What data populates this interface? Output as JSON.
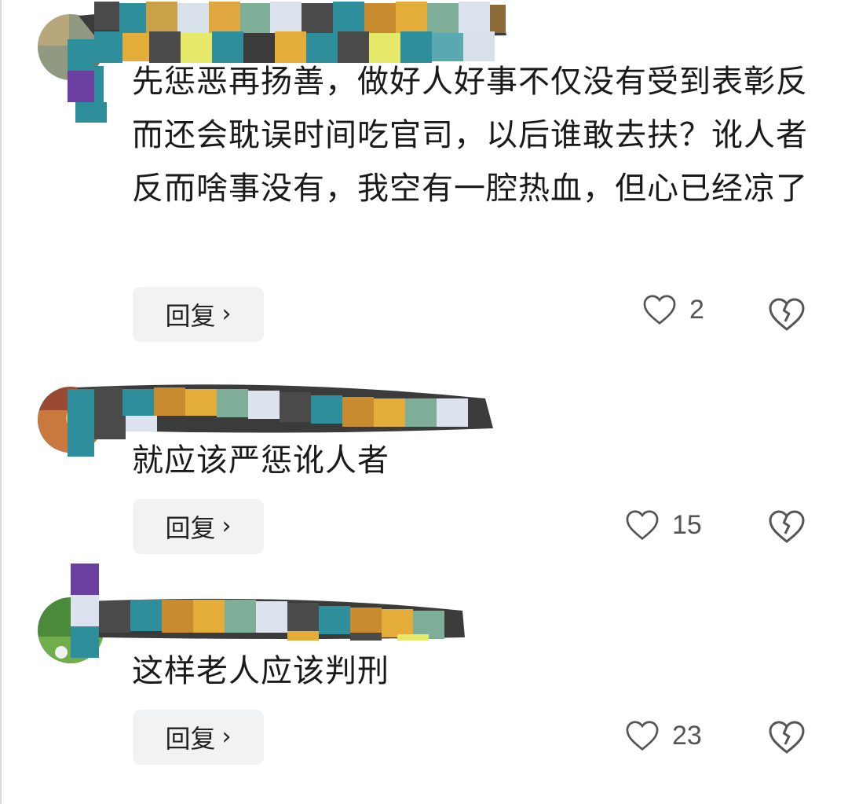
{
  "comments": [
    {
      "text": "先惩恶再扬善，做好人好事不仅没有受到表彰反而还会耽误时间吃官司，以后谁敢去扶？讹人者反而啥事没有，我空有一腔热血，但心已经凉了",
      "reply_label": "回复",
      "reply_chevron": "›",
      "like_count": "2",
      "like_icon": "heart-outline-icon",
      "dislike_icon": "broken-heart-icon"
    },
    {
      "text": "就应该严惩讹人者",
      "reply_label": "回复",
      "reply_chevron": "›",
      "like_count": "15",
      "like_icon": "heart-outline-icon",
      "dislike_icon": "broken-heart-icon"
    },
    {
      "text": "这样老人应该判刑",
      "reply_label": "回复",
      "reply_chevron": "›",
      "like_count": "23",
      "like_icon": "heart-outline-icon",
      "dislike_icon": "broken-heart-icon"
    }
  ],
  "colors": {
    "text": "#1a1a1a",
    "reply_bg": "#f1f2f4",
    "icon": "#555555"
  }
}
